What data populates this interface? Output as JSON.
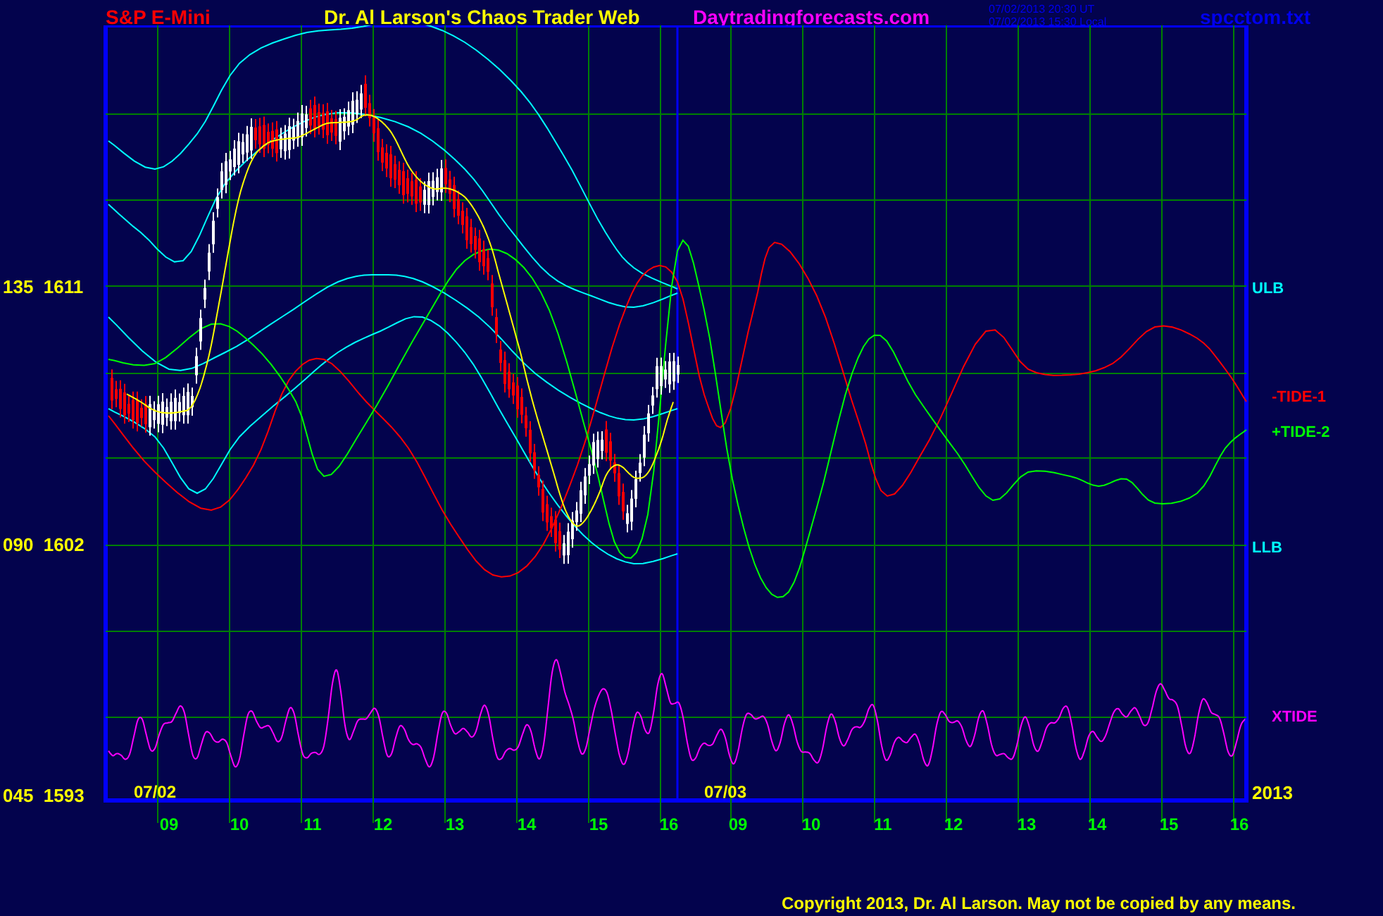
{
  "header": {
    "instrument": "S&P E-Mini",
    "site_title": "Dr. Al Larson's Chaos Trader Web",
    "website": "Daytradingforecasts.com",
    "timestamp_ut": "07/02/2013 20:30 UT",
    "timestamp_local": "07/02/2013 15:30 Local",
    "filename": "spcctom.txt"
  },
  "chart": {
    "y_labels": [
      "135  1611",
      "090  1602",
      "045  1593"
    ],
    "band_labels": [
      {
        "label": "ULB",
        "color": "#00ffff"
      },
      {
        "label": "-TIDE-1",
        "color": "#ff0000"
      },
      {
        "label": "+TIDE-2",
        "color": "#00ff00"
      },
      {
        "label": "LLB",
        "color": "#00ffff"
      },
      {
        "label": "XTIDE",
        "color": "#ff00ff"
      }
    ],
    "date_labels": [
      "07/02",
      "07/03"
    ],
    "year": "2013",
    "hour_labels": [
      "09",
      "10",
      "11",
      "12",
      "13",
      "14",
      "15",
      "16",
      "09",
      "10",
      "11",
      "12",
      "13",
      "14",
      "15",
      "16"
    ]
  },
  "footer": {
    "copyright": "Copyright 2013, Dr. Al Larson. May not be copied by any means."
  }
}
